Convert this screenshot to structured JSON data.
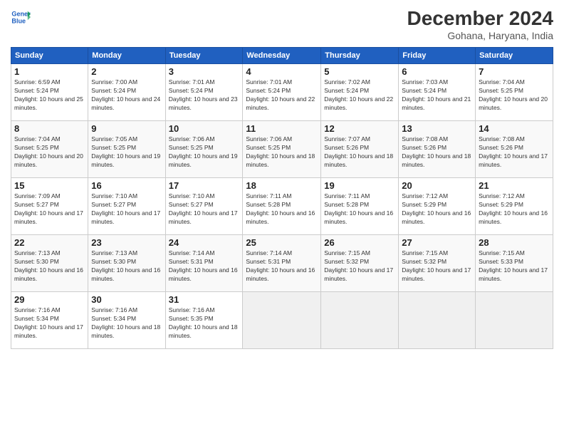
{
  "header": {
    "logo_line1": "General",
    "logo_line2": "Blue",
    "month": "December 2024",
    "location": "Gohana, Haryana, India"
  },
  "weekdays": [
    "Sunday",
    "Monday",
    "Tuesday",
    "Wednesday",
    "Thursday",
    "Friday",
    "Saturday"
  ],
  "weeks": [
    [
      {
        "day": "1",
        "rise": "Sunrise: 6:59 AM",
        "set": "Sunset: 5:24 PM",
        "light": "Daylight: 10 hours and 25 minutes."
      },
      {
        "day": "2",
        "rise": "Sunrise: 7:00 AM",
        "set": "Sunset: 5:24 PM",
        "light": "Daylight: 10 hours and 24 minutes."
      },
      {
        "day": "3",
        "rise": "Sunrise: 7:01 AM",
        "set": "Sunset: 5:24 PM",
        "light": "Daylight: 10 hours and 23 minutes."
      },
      {
        "day": "4",
        "rise": "Sunrise: 7:01 AM",
        "set": "Sunset: 5:24 PM",
        "light": "Daylight: 10 hours and 22 minutes."
      },
      {
        "day": "5",
        "rise": "Sunrise: 7:02 AM",
        "set": "Sunset: 5:24 PM",
        "light": "Daylight: 10 hours and 22 minutes."
      },
      {
        "day": "6",
        "rise": "Sunrise: 7:03 AM",
        "set": "Sunset: 5:24 PM",
        "light": "Daylight: 10 hours and 21 minutes."
      },
      {
        "day": "7",
        "rise": "Sunrise: 7:04 AM",
        "set": "Sunset: 5:25 PM",
        "light": "Daylight: 10 hours and 20 minutes."
      }
    ],
    [
      {
        "day": "8",
        "rise": "Sunrise: 7:04 AM",
        "set": "Sunset: 5:25 PM",
        "light": "Daylight: 10 hours and 20 minutes."
      },
      {
        "day": "9",
        "rise": "Sunrise: 7:05 AM",
        "set": "Sunset: 5:25 PM",
        "light": "Daylight: 10 hours and 19 minutes."
      },
      {
        "day": "10",
        "rise": "Sunrise: 7:06 AM",
        "set": "Sunset: 5:25 PM",
        "light": "Daylight: 10 hours and 19 minutes."
      },
      {
        "day": "11",
        "rise": "Sunrise: 7:06 AM",
        "set": "Sunset: 5:25 PM",
        "light": "Daylight: 10 hours and 18 minutes."
      },
      {
        "day": "12",
        "rise": "Sunrise: 7:07 AM",
        "set": "Sunset: 5:26 PM",
        "light": "Daylight: 10 hours and 18 minutes."
      },
      {
        "day": "13",
        "rise": "Sunrise: 7:08 AM",
        "set": "Sunset: 5:26 PM",
        "light": "Daylight: 10 hours and 18 minutes."
      },
      {
        "day": "14",
        "rise": "Sunrise: 7:08 AM",
        "set": "Sunset: 5:26 PM",
        "light": "Daylight: 10 hours and 17 minutes."
      }
    ],
    [
      {
        "day": "15",
        "rise": "Sunrise: 7:09 AM",
        "set": "Sunset: 5:27 PM",
        "light": "Daylight: 10 hours and 17 minutes."
      },
      {
        "day": "16",
        "rise": "Sunrise: 7:10 AM",
        "set": "Sunset: 5:27 PM",
        "light": "Daylight: 10 hours and 17 minutes."
      },
      {
        "day": "17",
        "rise": "Sunrise: 7:10 AM",
        "set": "Sunset: 5:27 PM",
        "light": "Daylight: 10 hours and 17 minutes."
      },
      {
        "day": "18",
        "rise": "Sunrise: 7:11 AM",
        "set": "Sunset: 5:28 PM",
        "light": "Daylight: 10 hours and 16 minutes."
      },
      {
        "day": "19",
        "rise": "Sunrise: 7:11 AM",
        "set": "Sunset: 5:28 PM",
        "light": "Daylight: 10 hours and 16 minutes."
      },
      {
        "day": "20",
        "rise": "Sunrise: 7:12 AM",
        "set": "Sunset: 5:29 PM",
        "light": "Daylight: 10 hours and 16 minutes."
      },
      {
        "day": "21",
        "rise": "Sunrise: 7:12 AM",
        "set": "Sunset: 5:29 PM",
        "light": "Daylight: 10 hours and 16 minutes."
      }
    ],
    [
      {
        "day": "22",
        "rise": "Sunrise: 7:13 AM",
        "set": "Sunset: 5:30 PM",
        "light": "Daylight: 10 hours and 16 minutes."
      },
      {
        "day": "23",
        "rise": "Sunrise: 7:13 AM",
        "set": "Sunset: 5:30 PM",
        "light": "Daylight: 10 hours and 16 minutes."
      },
      {
        "day": "24",
        "rise": "Sunrise: 7:14 AM",
        "set": "Sunset: 5:31 PM",
        "light": "Daylight: 10 hours and 16 minutes."
      },
      {
        "day": "25",
        "rise": "Sunrise: 7:14 AM",
        "set": "Sunset: 5:31 PM",
        "light": "Daylight: 10 hours and 16 minutes."
      },
      {
        "day": "26",
        "rise": "Sunrise: 7:15 AM",
        "set": "Sunset: 5:32 PM",
        "light": "Daylight: 10 hours and 17 minutes."
      },
      {
        "day": "27",
        "rise": "Sunrise: 7:15 AM",
        "set": "Sunset: 5:32 PM",
        "light": "Daylight: 10 hours and 17 minutes."
      },
      {
        "day": "28",
        "rise": "Sunrise: 7:15 AM",
        "set": "Sunset: 5:33 PM",
        "light": "Daylight: 10 hours and 17 minutes."
      }
    ],
    [
      {
        "day": "29",
        "rise": "Sunrise: 7:16 AM",
        "set": "Sunset: 5:34 PM",
        "light": "Daylight: 10 hours and 17 minutes."
      },
      {
        "day": "30",
        "rise": "Sunrise: 7:16 AM",
        "set": "Sunset: 5:34 PM",
        "light": "Daylight: 10 hours and 18 minutes."
      },
      {
        "day": "31",
        "rise": "Sunrise: 7:16 AM",
        "set": "Sunset: 5:35 PM",
        "light": "Daylight: 10 hours and 18 minutes."
      },
      null,
      null,
      null,
      null
    ]
  ]
}
